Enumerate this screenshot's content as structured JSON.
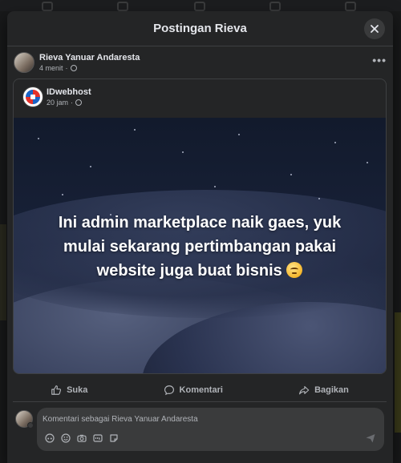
{
  "modal": {
    "title": "Postingan Rieva",
    "close_icon": "close-icon"
  },
  "post": {
    "author": "Rieva Yanuar Andaresta",
    "time": "4 menit",
    "audience_icon": "globe-icon",
    "more_icon": "more-horizontal-icon",
    "more_label": "•••"
  },
  "shared": {
    "page_name": "IDwebhost",
    "time": "20 jam",
    "audience_icon": "globe-icon",
    "image_caption": "Ini admin marketplace naik gaes, yuk mulai sekarang pertimbangan pakai website juga buat bisnis",
    "caption_emoji": "grimacing-smile-emoji"
  },
  "actions": {
    "like": "Suka",
    "comment": "Komentari",
    "share": "Bagikan"
  },
  "composer": {
    "placeholder": "Komentari sebagai Rieva Yanuar Andaresta",
    "value": "",
    "tools": [
      "avatar-sticker-icon",
      "emoji-icon",
      "camera-icon",
      "gif-icon",
      "sticker-icon"
    ],
    "send_icon": "send-icon"
  },
  "colors": {
    "background": "#18191a",
    "surface": "#242526",
    "input_surface": "#3a3b3c",
    "text_primary": "#e4e6eb",
    "text_secondary": "#b0b3b8"
  }
}
